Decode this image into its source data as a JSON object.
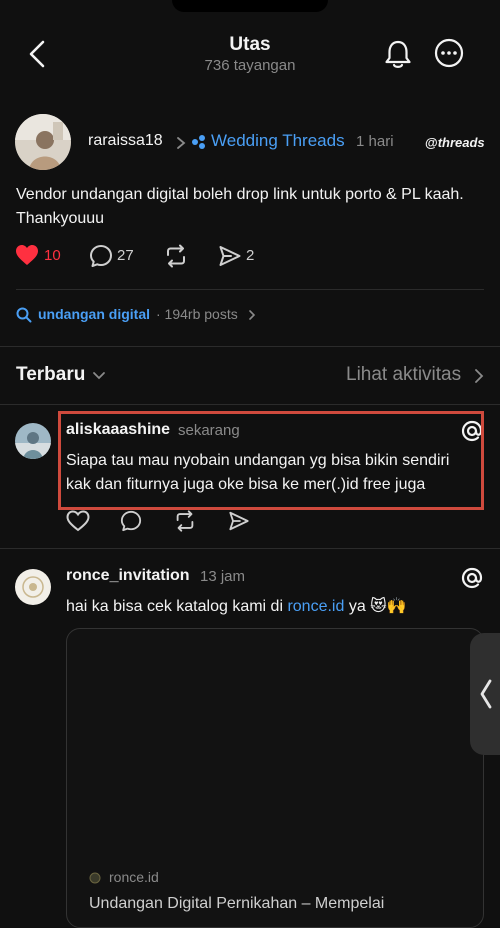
{
  "header": {
    "title": "Utas",
    "views": "736 tayangan"
  },
  "post": {
    "username": "raraissa18",
    "community": "Wedding Threads",
    "time": "1 hari",
    "brand": "threads",
    "text": "Vendor undangan digital boleh drop link untuk porto & PL kaah. Thankyouuu",
    "likes": "10",
    "comments": "27",
    "shares": "2",
    "like_color": "#ff3040"
  },
  "topic": {
    "tag": "undangan digital",
    "posts": "· 194rb posts"
  },
  "sort": {
    "label": "Terbaru",
    "activity": "Lihat aktivitas"
  },
  "replies": [
    {
      "username": "aliskaaashine",
      "time": "sekarang",
      "text": "Siapa tau mau nyobain undangan yg bisa bikin sendiri kak dan fiturnya juga oke bisa ke mer(.)id free juga"
    },
    {
      "username": "ronce_invitation",
      "time": "13 jam",
      "text_before": "hai ka bisa cek katalog kami di",
      "link": "ronce.id",
      "text_after": "ya 😻🙌",
      "card_domain": "ronce.id",
      "card_title": "Undangan Digital Pernikahan – Mempelai"
    }
  ],
  "colors": {
    "accent": "#4a9ff5",
    "highlight_border": "#cf4a3d",
    "background": "#101010"
  }
}
